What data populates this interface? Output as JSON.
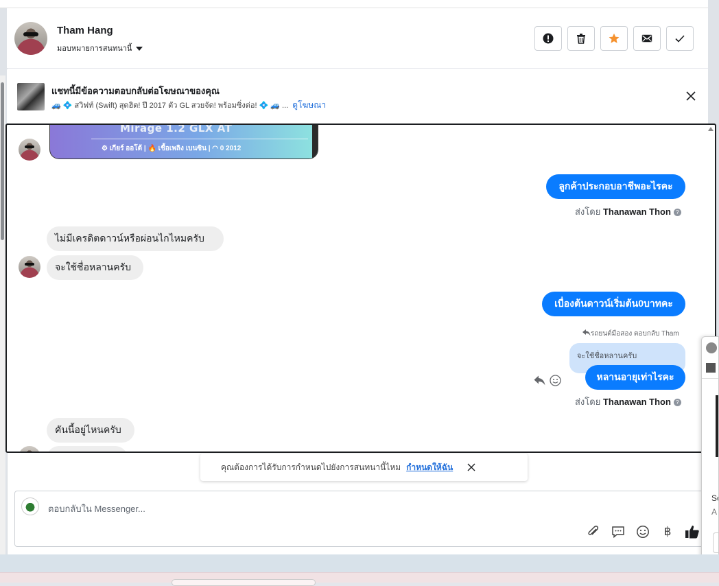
{
  "header": {
    "contact_name": "Tham Hang",
    "assign_label": "มอบหมายการสนทนานี้",
    "actions": [
      {
        "name": "report-spam-button",
        "icon": "exclamation-icon"
      },
      {
        "name": "delete-button",
        "icon": "trash-icon"
      },
      {
        "name": "star-button",
        "icon": "star-icon",
        "color": "#f5922f"
      },
      {
        "name": "mark-unread-button",
        "icon": "envelope-icon"
      },
      {
        "name": "mark-done-button",
        "icon": "check-icon"
      }
    ]
  },
  "ad_banner": {
    "title": "แชทนี้มีข้อความตอบกลับต่อโฆษณาของคุณ",
    "text": "🚙 💠 สวิฟท์ (Swift) สุดฮิต! ปี 2017 ตัว GL สวยจัด! พร้อมซิ่งต่อ! 💠 🚙 ...",
    "link": "ดูโฆษณา"
  },
  "chat": {
    "car_card": {
      "model": "Mirage 1.2 GLX AT",
      "specs": "⚙ เกียร์ ออโต้   |   🔥 เชื้อเพลิง เบนซิน   |   ◠ 0 2012"
    },
    "messages": {
      "out1": "ลูกค้าประกอบอาชีพอะไรคะ",
      "sent_by_1_prefix": "ส่งโดย",
      "sent_by_1_name": "Thanawan Thon",
      "in1": "ไม่มีเครดิตดาวน์หรือผ่อนไกไหมครับ",
      "in2": "จะใช้ชื่อหลานครับ",
      "out2": "เบื่องต้นดาวน์เริ่มต้น0บาทคะ",
      "reply_meta": "รถยนต์มือสอง ตอบกลับ Tham",
      "quoted": "จะใช้ชื่อหลานครับ",
      "out3": "หลานอายุเท่าไรคะ",
      "sent_by_2_prefix": "ส่งโดย",
      "sent_by_2_name": "Thanawan Thon",
      "in3": "คันนี้อยู่ไหนครับ"
    }
  },
  "toast": {
    "text": "คุณต้องการได้รับการกำหนดไปยังการสนทนานี้ไหม",
    "action": "กำหนดให้ฉัน"
  },
  "composer": {
    "placeholder": "ตอบกลับใน Messenger...",
    "tools": [
      "paperclip-icon",
      "chat-bubble-icon",
      "emoji-icon",
      "baht-icon",
      "thumbs-up-icon"
    ],
    "baht_symbol": "฿"
  },
  "side_popup": {
    "text1": "So",
    "text2": "A"
  },
  "colors": {
    "outgoing_bubble": "#0a7cff",
    "incoming_bubble": "#eeeeee",
    "link": "#216fdb",
    "star": "#f5922f"
  }
}
